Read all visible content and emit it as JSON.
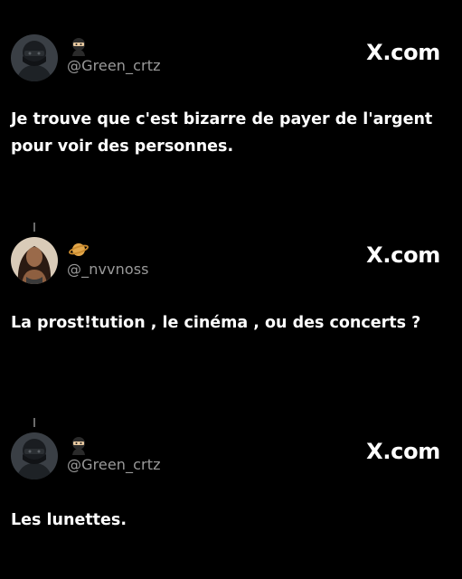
{
  "tweets": [
    {
      "avatar": "masked-person-avatar",
      "emoji": "ninja-emoji",
      "handle": "@Green_crtz",
      "source": "X.com",
      "text": "Je trouve que c'est bizarre de payer de l'argent pour voir des personnes."
    },
    {
      "avatar": "woman-avatar",
      "emoji": "ringed-planet-emoji",
      "handle": "@_nvvnoss",
      "source": "X.com",
      "text": "La prost!tution , le cinéma , ou des concerts ?"
    },
    {
      "avatar": "masked-person-avatar",
      "emoji": "ninja-emoji",
      "handle": "@Green_crtz",
      "source": "X.com",
      "text": "Les lunettes."
    }
  ],
  "colors": {
    "background": "#000000",
    "text": "#ffffff",
    "handle": "#9a9a9a",
    "thread_line": "#6b6b6b"
  }
}
